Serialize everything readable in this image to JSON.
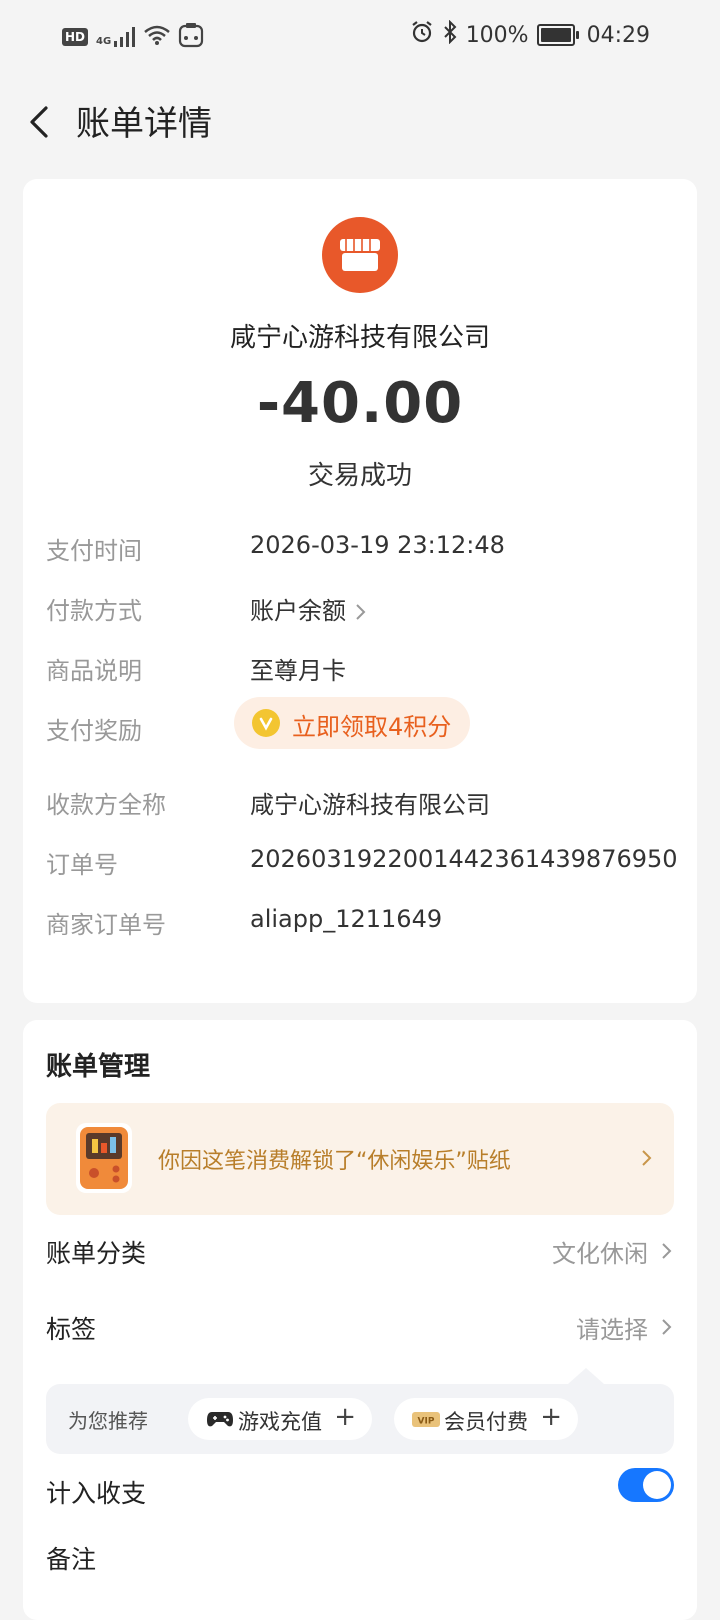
{
  "status_bar": {
    "hd": "HD",
    "net": "4G",
    "battery": "100%",
    "battery_level": 1.0,
    "time": "04:29"
  },
  "header": {
    "title": "账单详情"
  },
  "bill": {
    "merchant": "咸宁心游科技有限公司",
    "amount": "-40.00",
    "status": "交易成功"
  },
  "details": {
    "pay_time_label": "支付时间",
    "pay_time": "2026-03-19 23:12:48",
    "pay_method_label": "付款方式",
    "pay_method": "账户余额",
    "product_label": "商品说明",
    "product": "至尊月卡",
    "reward_label": "支付奖励",
    "reward": "立即领取4积分",
    "payee_label": "收款方全称",
    "payee": "咸宁心游科技有限公司",
    "order_label": "订单号",
    "order_no": "2026031922001442361439876950",
    "merchant_order_label": "商家订单号",
    "merchant_order_no": "aliapp_1211649"
  },
  "management": {
    "title": "账单管理",
    "sticker_text": "你因这笔消费解锁了“休闲娱乐”贴纸",
    "category_label": "账单分类",
    "category_value": "文化休闲",
    "tag_label": "标签",
    "tag_value": "请选择",
    "recommend_label": "为您推荐",
    "chips": [
      {
        "label": "游戏充值",
        "icon": "gamepad-icon"
      },
      {
        "label": "会员付费",
        "icon": "vip-icon",
        "icon_text": "VIP"
      }
    ],
    "include_label": "计入收支",
    "include_on": true,
    "note_label": "备注"
  },
  "colors": {
    "accent_blue": "#1677ff",
    "merchant_orange": "#e8582a",
    "reward_orange": "#e8601e",
    "sticker_gold": "#b87e2a"
  }
}
